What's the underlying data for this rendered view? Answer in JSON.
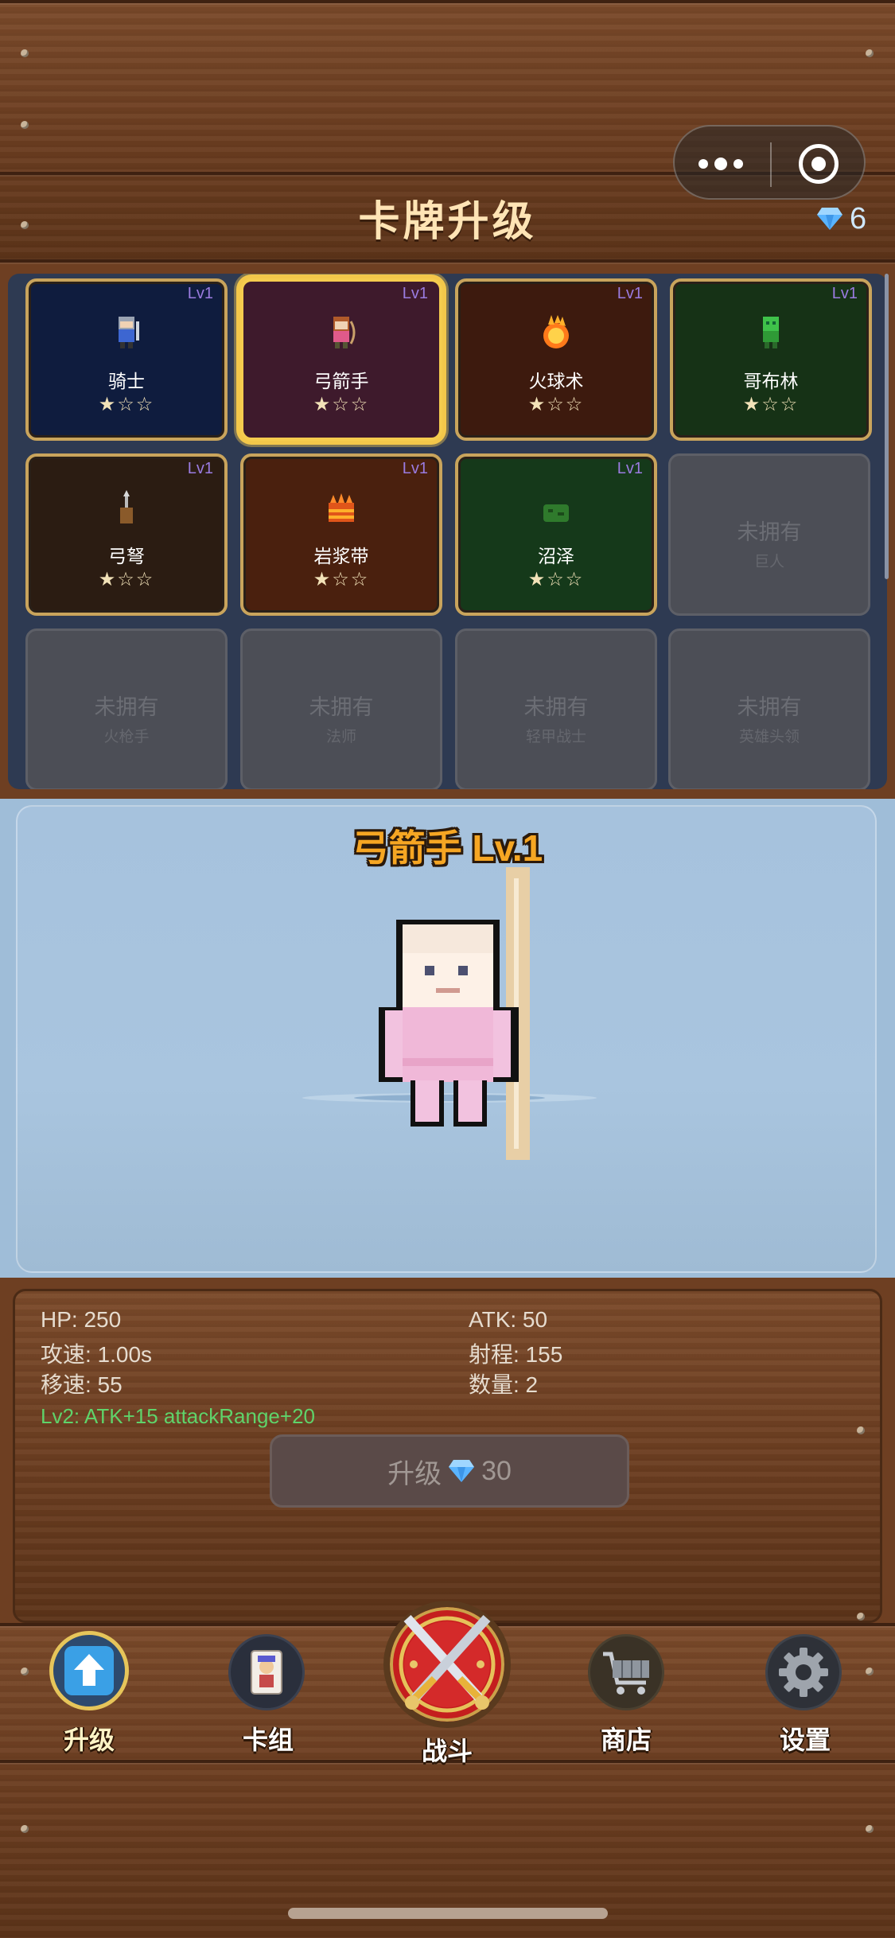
{
  "header": {
    "title": "卡牌升级",
    "gems": "6"
  },
  "cards": [
    {
      "name": "骑士",
      "level": "Lv1",
      "stars": "★☆☆",
      "bg": "#0f1c3e"
    },
    {
      "name": "弓箭手",
      "level": "Lv1",
      "stars": "★☆☆",
      "bg": "#3e1a2c",
      "selected": true
    },
    {
      "name": "火球术",
      "level": "Lv1",
      "stars": "★☆☆",
      "bg": "#3d1a0e"
    },
    {
      "name": "哥布林",
      "level": "Lv1",
      "stars": "★☆☆",
      "bg": "#163216"
    },
    {
      "name": "弓弩",
      "level": "Lv1",
      "stars": "★☆☆",
      "bg": "#2b1c12"
    },
    {
      "name": "岩浆带",
      "level": "Lv1",
      "stars": "★☆☆",
      "bg": "#4a200e"
    },
    {
      "name": "沼泽",
      "level": "Lv1",
      "stars": "★☆☆",
      "bg": "#15391a"
    }
  ],
  "locked_cards": [
    {
      "status": "未拥有",
      "name": "巨人"
    },
    {
      "status": "未拥有",
      "name": "火枪手"
    },
    {
      "status": "未拥有",
      "name": "法师"
    },
    {
      "status": "未拥有",
      "name": "轻甲战士"
    },
    {
      "status": "未拥有",
      "name": "英雄头领"
    }
  ],
  "preview": {
    "title": "弓箭手  Lv.1"
  },
  "stats": {
    "hp": "HP: 250",
    "atk": "ATK: 50",
    "attack_speed": "攻速: 1.00s",
    "range": "射程: 155",
    "move_speed": "移速: 55",
    "count": "数量: 2",
    "next_level_bonus": "Lv2: ATK+15  attackRange+20",
    "upgrade_label": "升级",
    "upgrade_cost": "30"
  },
  "nav": {
    "upgrade": "升级",
    "deck": "卡组",
    "battle": "战斗",
    "shop": "商店",
    "settings": "设置"
  },
  "colors": {
    "wood": "#6e3f22",
    "gold_border": "#c9a45c",
    "selected_border": "#f5cc4e",
    "bonus_text": "#5fd36a",
    "title_text": "#ffe4b5"
  }
}
